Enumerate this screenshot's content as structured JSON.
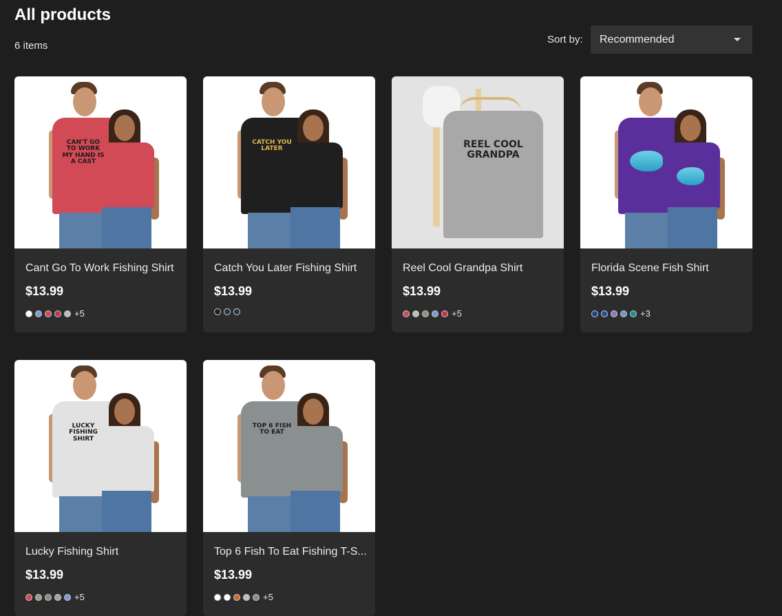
{
  "header": {
    "title": "All products",
    "count": "6 items",
    "sort_label": "Sort by:",
    "sort_value": "Recommended"
  },
  "products": [
    {
      "name": "Cant Go To Work Fishing Shirt",
      "price": "$13.99",
      "shirt_color": "#d14a56",
      "print_text": "CAN'T GO TO WORK MY HAND IS A CAST",
      "swatches": [
        "#ffffff",
        "#7b9bd1",
        "#d14a56",
        "#c0354d",
        "#bdbdbd"
      ],
      "more": "+5"
    },
    {
      "name": "Catch You Later Fishing Shirt",
      "price": "$13.99",
      "shirt_color": "#1f1f1f",
      "print_text": "CATCH YOU LATER",
      "swatches": [
        "#1f1f1f",
        "#243447",
        "#243447"
      ],
      "more": ""
    },
    {
      "name": "Reel Cool Grandpa Shirt",
      "price": "$13.99",
      "shirt_color": "#a8a8a8",
      "print_text": "REEL COOL GRANDPA",
      "swatches": [
        "#d14a56",
        "#bdbdbd",
        "#8b9279",
        "#7b9bd1",
        "#c0354d"
      ],
      "more": "+5"
    },
    {
      "name": "Florida Scene Fish Shirt",
      "price": "$13.99",
      "shirt_color": "#5b2f9b",
      "print_text": "",
      "swatches": [
        "#233f8c",
        "#1f4fa8",
        "#8e7bbf",
        "#6a9bc9",
        "#1a8f8f"
      ],
      "more": "+3"
    },
    {
      "name": "Lucky Fishing Shirt",
      "price": "$13.99",
      "shirt_color": "#e2e2e2",
      "print_text": "LUCKY FISHING SHIRT",
      "swatches": [
        "#d14a56",
        "#9a9a86",
        "#8a8a8a",
        "#a3a3a3",
        "#7b9bd1"
      ],
      "more": "+5"
    },
    {
      "name": "Top 6 Fish To Eat Fishing T-S...",
      "price": "$13.99",
      "shirt_color": "#8a9090",
      "print_text": "TOP 6 FISH TO EAT",
      "swatches": [
        "#ffffff",
        "#ffffff",
        "#d9652f",
        "#bdbdbd",
        "#8a8a8a"
      ],
      "more": "+5"
    }
  ],
  "icons": {
    "sort_caret": "chevron-down-icon"
  }
}
